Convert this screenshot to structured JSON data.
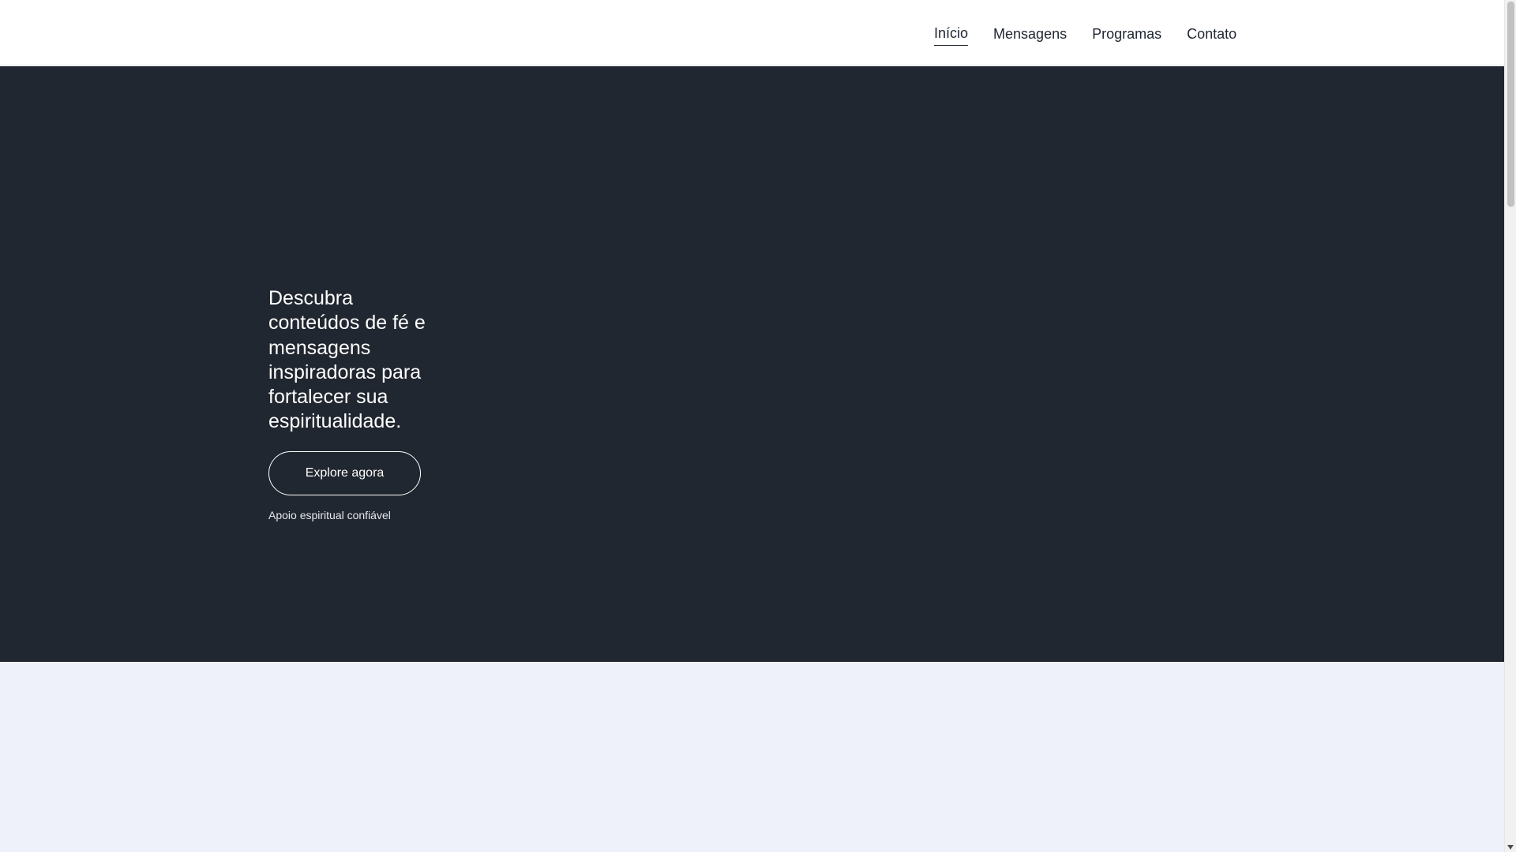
{
  "nav": {
    "items": [
      {
        "label": "Início",
        "active": true
      },
      {
        "label": "Mensagens",
        "active": false
      },
      {
        "label": "Programas",
        "active": false
      },
      {
        "label": "Contato",
        "active": false
      }
    ]
  },
  "hero": {
    "heading": "Descubra conteúdos de fé e mensagens inspiradoras para fortalecer sua espiritualidade.",
    "cta_label": "Explore agora",
    "tagline": "Apoio espiritual confiável"
  },
  "colors": {
    "hero_background": "#212730",
    "lower_background": "#eef1fa",
    "header_background": "#ffffff",
    "text_dark": "#1e2530"
  },
  "icons": {
    "scroll_down": "chevron-down-icon"
  }
}
